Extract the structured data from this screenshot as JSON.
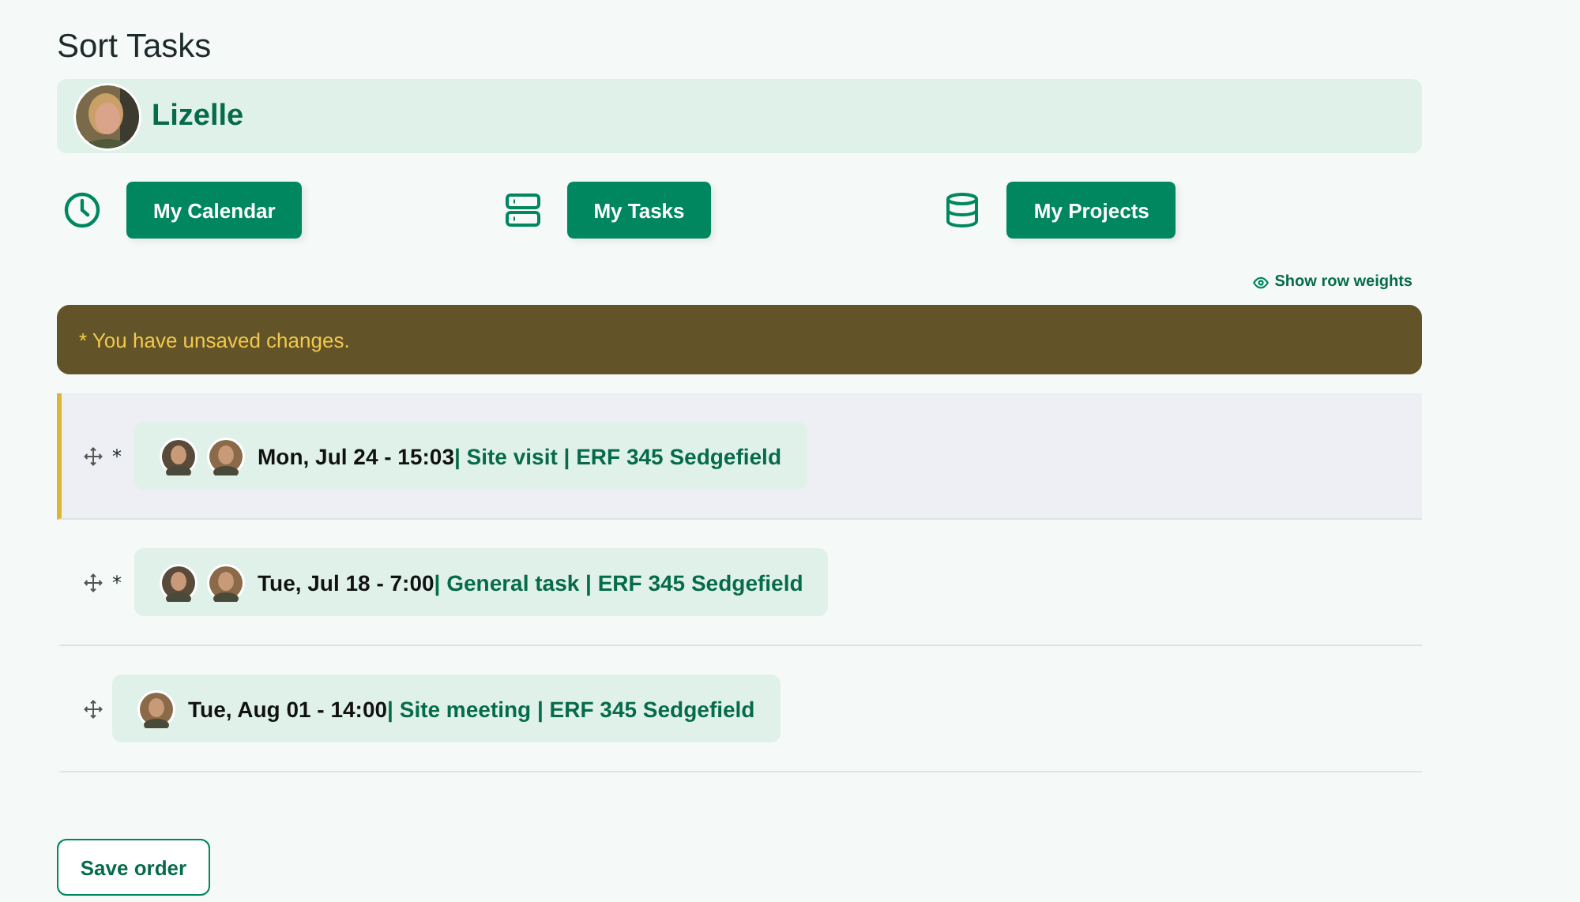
{
  "title": "Sort Tasks",
  "user": {
    "name": "Lizelle"
  },
  "nav": [
    {
      "kind": "calendar",
      "label": "My Calendar"
    },
    {
      "kind": "tasks",
      "label": "My Tasks"
    },
    {
      "kind": "projects",
      "label": "My Projects"
    }
  ],
  "weights_link": "Show row weights",
  "alert": "* You have unsaved changes.",
  "tasks": [
    {
      "selected": true,
      "marker": "*",
      "when": "Mon, Jul 24 - 15:03",
      "detail": "| Site visit | ERF 345 Sedgefield"
    },
    {
      "selected": false,
      "marker": "*",
      "when": "Tue, Jul 18 - 7:00",
      "detail": "| General task | ERF 345 Sedgefield"
    },
    {
      "selected": false,
      "when": "Tue, Aug 01 - 14:00",
      "detail": "| Site meeting | ERF 345 Sedgefield"
    }
  ],
  "save_button": "Save order"
}
